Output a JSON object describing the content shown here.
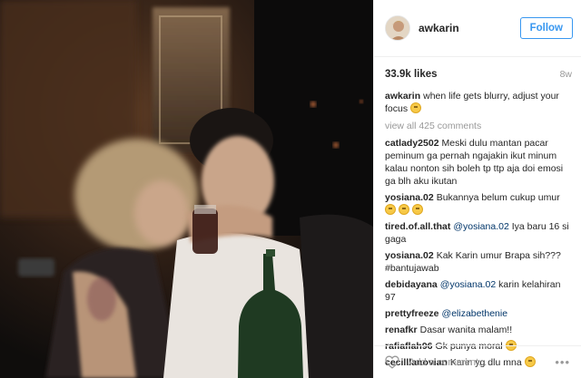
{
  "post": {
    "username": "awkarin",
    "follow_label": "Follow",
    "likes": "33.9k likes",
    "age": "8w",
    "caption_user": "awkarin",
    "caption_text": "when life gets blurry, adjust your focus",
    "view_all": "view all 425 comments"
  },
  "comments": [
    {
      "user": "catlady2502",
      "text": "Meski dulu mantan pacar peminum ga pernah ngajakin ikut minum kalau nonton sih boleh tp ttp aja doi emosi ga blh aku ikutan"
    },
    {
      "user": "yosiana.02",
      "text": "Bukannya belum cukup umur"
    },
    {
      "user": "tired.of.all.that",
      "mention": "@yosiana.02",
      "text": "Iya baru 16 si gaga"
    },
    {
      "user": "yosiana.02",
      "text": "Kak Karin umur Brapa sih??? #bantujawab"
    },
    {
      "user": "debidayana",
      "mention": "@yosiana.02",
      "text": "karin kelahiran 97"
    },
    {
      "user": "prettyfreeze",
      "mention": "@elizabethenie",
      "text": ""
    },
    {
      "user": "renafkr",
      "text": "Dasar wanita malam!!"
    },
    {
      "user": "rafiaflah96",
      "text": "Gk punya moral"
    },
    {
      "user": "cecilllanovian",
      "text": "Karin yg dlu mna"
    }
  ],
  "add_comment": {
    "placeholder": "Add a comment..."
  },
  "icons": {
    "like": "heart-outline-icon",
    "options": "more-options-icon",
    "emoji": "emoji-icon"
  },
  "colors": {
    "follow_blue": "#3897f0",
    "muted": "#999999",
    "mention": "#003569"
  }
}
